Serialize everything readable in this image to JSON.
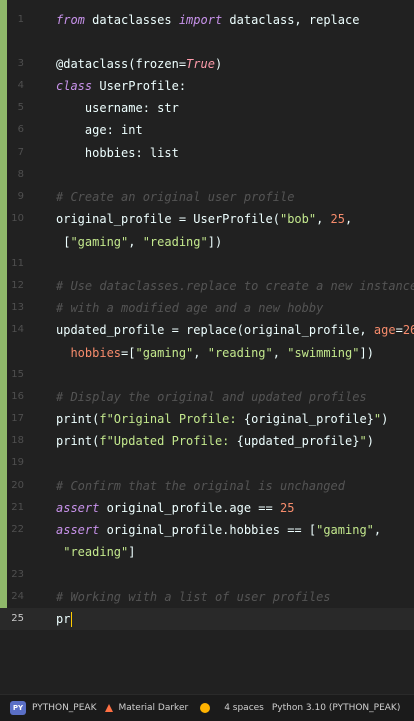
{
  "editor": {
    "accent_bar_color": "#c3e88d",
    "line_numbers": [
      "1",
      "2",
      "3",
      "4",
      "5",
      "6",
      "7",
      "8",
      "9",
      "10",
      "",
      "11",
      "12",
      "13",
      "14",
      "",
      "15",
      "16",
      "17",
      "18",
      "19",
      "20",
      "21",
      "22",
      "",
      "23",
      "24",
      "25"
    ],
    "active_line": "25"
  },
  "code": {
    "l1_kw1": "from",
    "l1_t1": " dataclasses ",
    "l1_kw2": "import",
    "l1_t2": " dataclass, replace",
    "l3_t1": "@dataclass(frozen=",
    "l3_b": "True",
    "l3_t2": ")",
    "l4_kw": "class",
    "l4_t": " UserProfile:",
    "l5": "    username: str",
    "l6": "    age: int",
    "l7": "    hobbies: list",
    "l9": "# Create an original user profile",
    "l10_t1": "original_profile = UserProfile(",
    "l10_s": "\"bob\"",
    "l10_t2": ", ",
    "l10_n": "25",
    "l10_t3": ",",
    "l10b_t1": " [",
    "l10b_s1": "\"gaming\"",
    "l10b_t2": ", ",
    "l10b_s2": "\"reading\"",
    "l10b_t3": "])",
    "l12": "# Use dataclasses.replace to create a new instance",
    "l13": "# with a modified age and a new hobby",
    "l14_t1": "updated_profile = replace(original_profile, ",
    "l14_p": "age",
    "l14_t2": "=",
    "l14_n": "26",
    "l14_t3": ",",
    "l14b_p": "  hobbies",
    "l14b_t1": "=[",
    "l14b_s1": "\"gaming\"",
    "l14b_t2": ", ",
    "l14b_s2": "\"reading\"",
    "l14b_t3": ", ",
    "l14b_s3": "\"swimming\"",
    "l14b_t4": "])",
    "l16": "# Display the original and updated profiles",
    "l17_t1": "print(",
    "l17_s1": "f\"Original Profile: ",
    "l17_t2": "{original_profile}",
    "l17_s2": "\"",
    "l17_t3": ")",
    "l18_t1": "print(",
    "l18_s1": "f\"Updated Profile: ",
    "l18_t2": "{updated_profile}",
    "l18_s2": "\"",
    "l18_t3": ")",
    "l20": "# Confirm that the original is unchanged",
    "l21_kw": "assert",
    "l21_t": " original_profile.age == ",
    "l21_n": "25",
    "l22_kw": "assert",
    "l22_t": " original_profile.hobbies == [",
    "l22_s": "\"gaming\"",
    "l22_t2": ",",
    "l22b_t1": " ",
    "l22b_s": "\"reading\"",
    "l22b_t2": "]",
    "l24": "# Working with a list of user profiles",
    "l25": "pr"
  },
  "statusbar": {
    "interpreter_badge": "PY",
    "project": "PYTHON_PEAK",
    "theme": "Material Darker",
    "indent": "4 spaces",
    "python": "Python 3.10 (PYTHON_PEAK)",
    "badge_color": "#5a6fc6",
    "status_dot_color": "#ffb300"
  }
}
